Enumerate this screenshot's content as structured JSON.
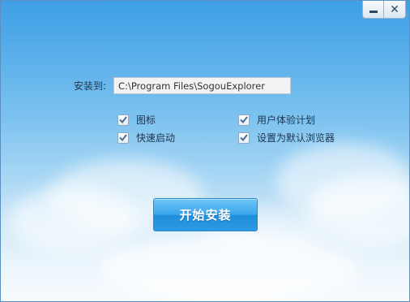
{
  "window": {
    "minimize_icon": "minimize-icon",
    "close_label": "✕"
  },
  "install": {
    "label": "安装到:",
    "path_value": "C:\\Program Files\\SogouExplorer"
  },
  "options": [
    {
      "label": "图标",
      "checked": true
    },
    {
      "label": "快速启动",
      "checked": true
    },
    {
      "label": "用户体验计划",
      "checked": true
    },
    {
      "label": "设置为默认浏览器",
      "checked": true
    }
  ],
  "actions": {
    "install_button_label": "开始安装"
  },
  "colors": {
    "sky_top": "#3f9fe6",
    "sky_bottom": "#f7fbfe",
    "button_blue": "#2c9ae3",
    "check_color": "#4a6f93"
  }
}
